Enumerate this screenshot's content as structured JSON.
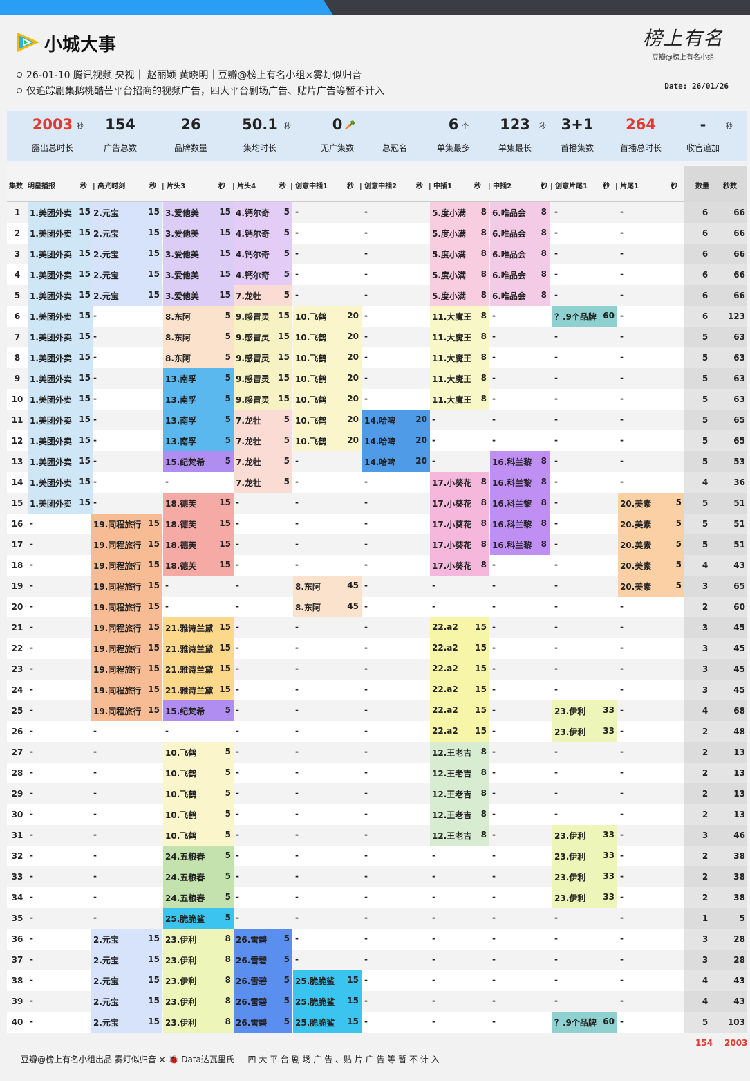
{
  "header": {
    "title": "小城大事",
    "line1": "26-01-10 腾讯视频 央视｜ 赵丽颖 黄晓明｜豆瓣@榜上有名小组×雾灯似归音",
    "line2": "仅追踪剧集鹅桃酷芒平台招商的视频广告，四大平台剧场广告、贴片广告等暂不计入",
    "sig": "榜上有名",
    "sig_sub": "豆瓣@榜上有名小组",
    "date": "Date: 26/01/26"
  },
  "stats": [
    {
      "value": "2003",
      "unit": "秒",
      "label": "露出总时长",
      "red": true
    },
    {
      "value": "154",
      "unit": "",
      "label": "广告总数"
    },
    {
      "value": "26",
      "unit": "",
      "label": "品牌数量"
    },
    {
      "value": "50.1",
      "unit": "秒",
      "label": "集均时长"
    },
    {
      "value": "0",
      "unit": "🥕",
      "label": "无广集数"
    },
    {
      "value": "",
      "unit": "",
      "label": "总冠名"
    },
    {
      "value": "6",
      "unit": "个",
      "label": "单集最多"
    },
    {
      "value": "123",
      "unit": "秒",
      "label": "单集最长"
    },
    {
      "value": "3+1",
      "unit": "",
      "label": "首播集数"
    },
    {
      "value": "264",
      "unit": "",
      "label": "首播总时长",
      "red": true
    },
    {
      "value": "-",
      "unit": "秒",
      "label": "收官追加"
    }
  ],
  "columns": [
    "集数",
    "明星播报",
    "秒",
    "| 高光时刻",
    "秒",
    "| 片头3",
    "秒",
    "| 片头4",
    "秒",
    "| 创意中插1",
    "秒",
    "| 创意中插2",
    "秒",
    "| 中插1",
    "秒",
    "| 中插2",
    "秒",
    "| 创意片尾1",
    "秒",
    "| 片尾1",
    "秒",
    "数量",
    "秒数"
  ],
  "colors": {
    "美团外卖": "#cfe6f7",
    "元宝": "#d6e3fb",
    "爱他美": "#dccdf7",
    "钙尔奇": "#e3cdf7",
    "龙牡": "#fbdcd4",
    "度小满": "#f9cde0",
    "唯品会": "#f4cbe6",
    "东阿": "#fbe2cc",
    "感冒灵": "#f7f2c4",
    "飞鹤": "#fbf5cc",
    "大魔王": "#f7f7c8",
    "南孚": "#5bb8ee",
    "哈啤": "#4f9be8",
    "科兰黎": "#bf8ff3",
    "纪梵希": "#b08df0",
    "小葵花": "#f5b8dc",
    "德芙": "#f6aaa6",
    "美素": "#fbd0a4",
    "同程旅行": "#f7bc94",
    "雅诗兰黛": "#fbd88a",
    "a2": "#f6f5a8",
    "伊利": "#eef5b8",
    "王老吉": "#d7ecd0",
    "五粮春": "#c3e2ad",
    "脆脆鲨": "#3cc4f0",
    "雪碧": "#5a8ff0",
    "9个品牌": "#8fd0d0"
  },
  "rows": [
    [
      1,
      [
        "1.美团外卖",
        15
      ],
      [
        "2.元宝",
        15
      ],
      [
        "3.爱他美",
        15
      ],
      [
        "4.钙尔奇",
        5
      ],
      "-",
      "-",
      [
        "5.度小满",
        8
      ],
      [
        "6.唯品会",
        8
      ],
      "-",
      "-",
      6,
      66
    ],
    [
      2,
      [
        "1.美团外卖",
        15
      ],
      [
        "2.元宝",
        15
      ],
      [
        "3.爱他美",
        15
      ],
      [
        "4.钙尔奇",
        5
      ],
      "-",
      "-",
      [
        "5.度小满",
        8
      ],
      [
        "6.唯品会",
        8
      ],
      "-",
      "-",
      6,
      66
    ],
    [
      3,
      [
        "1.美团外卖",
        15
      ],
      [
        "2.元宝",
        15
      ],
      [
        "3.爱他美",
        15
      ],
      [
        "4.钙尔奇",
        5
      ],
      "-",
      "-",
      [
        "5.度小满",
        8
      ],
      [
        "6.唯品会",
        8
      ],
      "-",
      "-",
      6,
      66
    ],
    [
      4,
      [
        "1.美团外卖",
        15
      ],
      [
        "2.元宝",
        15
      ],
      [
        "3.爱他美",
        15
      ],
      [
        "4.钙尔奇",
        5
      ],
      "-",
      "-",
      [
        "5.度小满",
        8
      ],
      [
        "6.唯品会",
        8
      ],
      "-",
      "-",
      6,
      66
    ],
    [
      5,
      [
        "1.美团外卖",
        15
      ],
      [
        "2.元宝",
        15
      ],
      [
        "3.爱他美",
        15
      ],
      [
        "7.龙牡",
        5
      ],
      "-",
      "-",
      [
        "5.度小满",
        8
      ],
      [
        "6.唯品会",
        8
      ],
      "-",
      "-",
      6,
      66
    ],
    [
      6,
      [
        "1.美团外卖",
        15
      ],
      "-",
      [
        "8.东阿",
        5
      ],
      [
        "9.感冒灵",
        15
      ],
      [
        "10.飞鹤",
        20
      ],
      "-",
      [
        "11.大魔王",
        8
      ],
      "-",
      [
        "？.9个品牌",
        60
      ],
      "-",
      6,
      123
    ],
    [
      7,
      [
        "1.美团外卖",
        15
      ],
      "-",
      [
        "8.东阿",
        5
      ],
      [
        "9.感冒灵",
        15
      ],
      [
        "10.飞鹤",
        20
      ],
      "-",
      [
        "11.大魔王",
        8
      ],
      "-",
      "-",
      "-",
      5,
      63
    ],
    [
      8,
      [
        "1.美团外卖",
        15
      ],
      "-",
      [
        "8.东阿",
        5
      ],
      [
        "9.感冒灵",
        15
      ],
      [
        "10.飞鹤",
        20
      ],
      "-",
      [
        "11.大魔王",
        8
      ],
      "-",
      "-",
      "-",
      5,
      63
    ],
    [
      9,
      [
        "1.美团外卖",
        15
      ],
      "-",
      [
        "13.南孚",
        5
      ],
      [
        "9.感冒灵",
        15
      ],
      [
        "10.飞鹤",
        20
      ],
      "-",
      [
        "11.大魔王",
        8
      ],
      "-",
      "-",
      "-",
      5,
      63
    ],
    [
      10,
      [
        "1.美团外卖",
        15
      ],
      "-",
      [
        "13.南孚",
        5
      ],
      [
        "9.感冒灵",
        15
      ],
      [
        "10.飞鹤",
        20
      ],
      "-",
      [
        "11.大魔王",
        8
      ],
      "-",
      "-",
      "-",
      5,
      63
    ],
    [
      11,
      [
        "1.美团外卖",
        15
      ],
      "-",
      [
        "13.南孚",
        5
      ],
      [
        "7.龙牡",
        5
      ],
      [
        "10.飞鹤",
        20
      ],
      [
        "14.哈啤",
        20
      ],
      "-",
      "-",
      "-",
      "-",
      5,
      65
    ],
    [
      12,
      [
        "1.美团外卖",
        15
      ],
      "-",
      [
        "13.南孚",
        5
      ],
      [
        "7.龙牡",
        5
      ],
      [
        "10.飞鹤",
        20
      ],
      [
        "14.哈啤",
        20
      ],
      "-",
      "-",
      "-",
      "-",
      5,
      65
    ],
    [
      13,
      [
        "1.美团外卖",
        15
      ],
      "-",
      [
        "15.纪梵希",
        5
      ],
      [
        "7.龙牡",
        5
      ],
      "-",
      [
        "14.哈啤",
        20
      ],
      "-",
      [
        "16.科兰黎",
        8
      ],
      "-",
      "-",
      5,
      53
    ],
    [
      14,
      [
        "1.美团外卖",
        15
      ],
      "-",
      "-",
      [
        "7.龙牡",
        5
      ],
      "-",
      "-",
      [
        "17.小葵花",
        8
      ],
      [
        "16.科兰黎",
        8
      ],
      "-",
      "-",
      4,
      36
    ],
    [
      15,
      [
        "1.美团外卖",
        15
      ],
      "-",
      [
        "18.德芙",
        15
      ],
      "-",
      "-",
      "-",
      [
        "17.小葵花",
        8
      ],
      [
        "16.科兰黎",
        8
      ],
      "-",
      [
        "20.美素",
        5
      ],
      5,
      51
    ],
    [
      16,
      "-",
      [
        "19.同程旅行",
        15
      ],
      [
        "18.德芙",
        15
      ],
      "-",
      "-",
      "-",
      [
        "17.小葵花",
        8
      ],
      [
        "16.科兰黎",
        8
      ],
      "-",
      [
        "20.美素",
        5
      ],
      5,
      51
    ],
    [
      17,
      "-",
      [
        "19.同程旅行",
        15
      ],
      [
        "18.德芙",
        15
      ],
      "-",
      "-",
      "-",
      [
        "17.小葵花",
        8
      ],
      [
        "16.科兰黎",
        8
      ],
      "-",
      [
        "20.美素",
        5
      ],
      5,
      51
    ],
    [
      18,
      "-",
      [
        "19.同程旅行",
        15
      ],
      [
        "18.德芙",
        15
      ],
      "-",
      "-",
      "-",
      [
        "17.小葵花",
        8
      ],
      "-",
      "-",
      [
        "20.美素",
        5
      ],
      4,
      43
    ],
    [
      19,
      "-",
      [
        "19.同程旅行",
        15
      ],
      "-",
      "-",
      [
        "8.东阿",
        45
      ],
      "-",
      "-",
      "-",
      "-",
      [
        "20.美素",
        5
      ],
      3,
      65
    ],
    [
      20,
      "-",
      [
        "19.同程旅行",
        15
      ],
      "-",
      "-",
      [
        "8.东阿",
        45
      ],
      "-",
      "-",
      "-",
      "-",
      "-",
      2,
      60
    ],
    [
      21,
      "-",
      [
        "19.同程旅行",
        15
      ],
      [
        "21.雅诗兰黛",
        15
      ],
      "-",
      "-",
      "-",
      [
        "22.a2",
        15
      ],
      "-",
      "-",
      "-",
      3,
      45
    ],
    [
      22,
      "-",
      [
        "19.同程旅行",
        15
      ],
      [
        "21.雅诗兰黛",
        15
      ],
      "-",
      "-",
      "-",
      [
        "22.a2",
        15
      ],
      "-",
      "-",
      "-",
      3,
      45
    ],
    [
      23,
      "-",
      [
        "19.同程旅行",
        15
      ],
      [
        "21.雅诗兰黛",
        15
      ],
      "-",
      "-",
      "-",
      [
        "22.a2",
        15
      ],
      "-",
      "-",
      "-",
      3,
      45
    ],
    [
      24,
      "-",
      [
        "19.同程旅行",
        15
      ],
      [
        "21.雅诗兰黛",
        15
      ],
      "-",
      "-",
      "-",
      [
        "22.a2",
        15
      ],
      "-",
      "-",
      "-",
      3,
      45
    ],
    [
      25,
      "-",
      [
        "19.同程旅行",
        15
      ],
      [
        "15.纪梵希",
        5
      ],
      "-",
      "-",
      "-",
      [
        "22.a2",
        15
      ],
      "-",
      [
        "23.伊利",
        33
      ],
      "-",
      4,
      68
    ],
    [
      26,
      "-",
      "-",
      "-",
      "-",
      "-",
      "-",
      [
        "22.a2",
        15
      ],
      "-",
      [
        "23.伊利",
        33
      ],
      "-",
      2,
      48
    ],
    [
      27,
      "-",
      "-",
      [
        "10.飞鹤",
        5
      ],
      "-",
      "-",
      "-",
      [
        "12.王老吉",
        8
      ],
      "-",
      "-",
      "-",
      2,
      13
    ],
    [
      28,
      "-",
      "-",
      [
        "10.飞鹤",
        5
      ],
      "-",
      "-",
      "-",
      [
        "12.王老吉",
        8
      ],
      "-",
      "-",
      "-",
      2,
      13
    ],
    [
      29,
      "-",
      "-",
      [
        "10.飞鹤",
        5
      ],
      "-",
      "-",
      "-",
      [
        "12.王老吉",
        8
      ],
      "-",
      "-",
      "-",
      2,
      13
    ],
    [
      30,
      "-",
      "-",
      [
        "10.飞鹤",
        5
      ],
      "-",
      "-",
      "-",
      [
        "12.王老吉",
        8
      ],
      "-",
      "-",
      "-",
      2,
      13
    ],
    [
      31,
      "-",
      "-",
      [
        "10.飞鹤",
        5
      ],
      "-",
      "-",
      "-",
      [
        "12.王老吉",
        8
      ],
      "-",
      [
        "23.伊利",
        33
      ],
      "-",
      3,
      46
    ],
    [
      32,
      "-",
      "-",
      [
        "24.五粮春",
        5
      ],
      "-",
      "-",
      "-",
      "-",
      "-",
      [
        "23.伊利",
        33
      ],
      "-",
      2,
      38
    ],
    [
      33,
      "-",
      "-",
      [
        "24.五粮春",
        5
      ],
      "-",
      "-",
      "-",
      "-",
      "-",
      [
        "23.伊利",
        33
      ],
      "-",
      2,
      38
    ],
    [
      34,
      "-",
      "-",
      [
        "24.五粮春",
        5
      ],
      "-",
      "-",
      "-",
      "-",
      "-",
      [
        "23.伊利",
        33
      ],
      "-",
      2,
      38
    ],
    [
      35,
      "-",
      "-",
      [
        "25.脆脆鲨",
        5
      ],
      "-",
      "-",
      "-",
      "-",
      "-",
      "-",
      "-",
      1,
      5
    ],
    [
      36,
      "-",
      [
        "2.元宝",
        15
      ],
      [
        "23.伊利",
        8
      ],
      [
        "26.雪碧",
        5
      ],
      "-",
      "-",
      "-",
      "-",
      "-",
      "-",
      3,
      28
    ],
    [
      37,
      "-",
      [
        "2.元宝",
        15
      ],
      [
        "23.伊利",
        8
      ],
      [
        "26.雪碧",
        5
      ],
      "-",
      "-",
      "-",
      "-",
      "-",
      "-",
      3,
      28
    ],
    [
      38,
      "-",
      [
        "2.元宝",
        15
      ],
      [
        "23.伊利",
        8
      ],
      [
        "26.雪碧",
        5
      ],
      [
        "25.脆脆鲨",
        15
      ],
      "-",
      "-",
      "-",
      "-",
      "-",
      4,
      43
    ],
    [
      39,
      "-",
      [
        "2.元宝",
        15
      ],
      [
        "23.伊利",
        8
      ],
      [
        "26.雪碧",
        5
      ],
      [
        "25.脆脆鲨",
        15
      ],
      "-",
      "-",
      "-",
      "-",
      "-",
      4,
      43
    ],
    [
      40,
      "-",
      [
        "2.元宝",
        15
      ],
      [
        "23.伊利",
        8
      ],
      [
        "26.雪碧",
        5
      ],
      [
        "25.脆脆鲨",
        15
      ],
      "-",
      "-",
      "-",
      [
        "？.9个品牌",
        60
      ],
      "-",
      5,
      103
    ]
  ],
  "footer": {
    "text": "豆瓣@榜上有名小组出品  雾灯似归音 × 🐞 Data达瓦里氏 ｜ 四 大 平 台 剧 场 广 告 、贴 片 广 告 等 暂 不 计 入",
    "total_count": "154",
    "total_secs": "2003"
  }
}
